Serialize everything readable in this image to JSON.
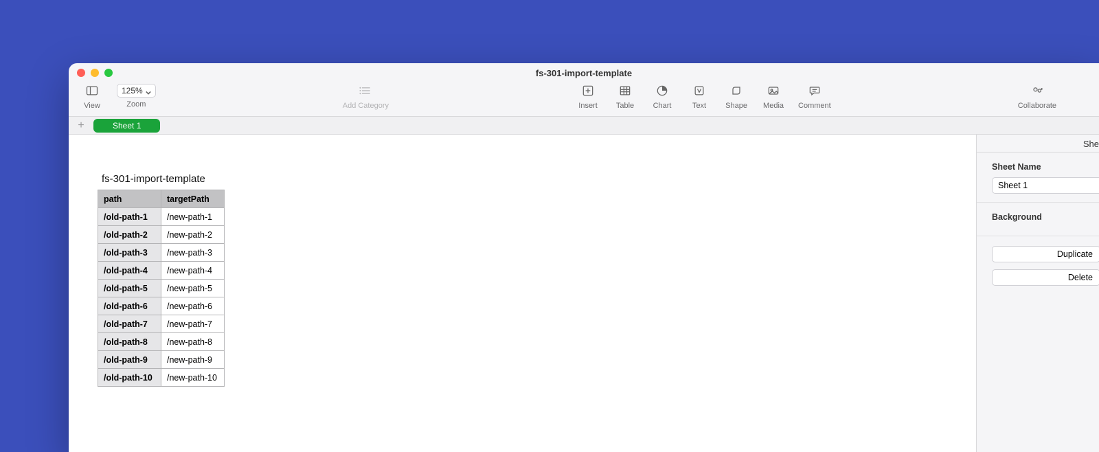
{
  "window": {
    "title": "fs-301-import-template"
  },
  "toolbar": {
    "view_label": "View",
    "zoom_value": "125%",
    "zoom_label": "Zoom",
    "add_category_label": "Add Category",
    "insert_label": "Insert",
    "table_label": "Table",
    "chart_label": "Chart",
    "text_label": "Text",
    "shape_label": "Shape",
    "media_label": "Media",
    "comment_label": "Comment",
    "collaborate_label": "Collaborate"
  },
  "sheets": {
    "active_tab": "Sheet 1"
  },
  "table": {
    "title": "fs-301-import-template",
    "headers": [
      "path",
      "targetPath"
    ],
    "rows": [
      {
        "a": "/old-path-1",
        "b": "/new-path-1"
      },
      {
        "a": "/old-path-2",
        "b": "/new-path-2"
      },
      {
        "a": "/old-path-3",
        "b": "/new-path-3"
      },
      {
        "a": "/old-path-4",
        "b": "/new-path-4"
      },
      {
        "a": "/old-path-5",
        "b": "/new-path-5"
      },
      {
        "a": "/old-path-6",
        "b": "/new-path-6"
      },
      {
        "a": "/old-path-7",
        "b": "/new-path-7"
      },
      {
        "a": "/old-path-8",
        "b": "/new-path-8"
      },
      {
        "a": "/old-path-9",
        "b": "/new-path-9"
      },
      {
        "a": "/old-path-10",
        "b": "/new-path-10"
      }
    ]
  },
  "inspector": {
    "tab_label": "She",
    "sheet_name_label": "Sheet Name",
    "sheet_name_value": "Sheet 1",
    "background_label": "Background",
    "duplicate_label": "Duplicate",
    "delete_label": "Delete"
  }
}
